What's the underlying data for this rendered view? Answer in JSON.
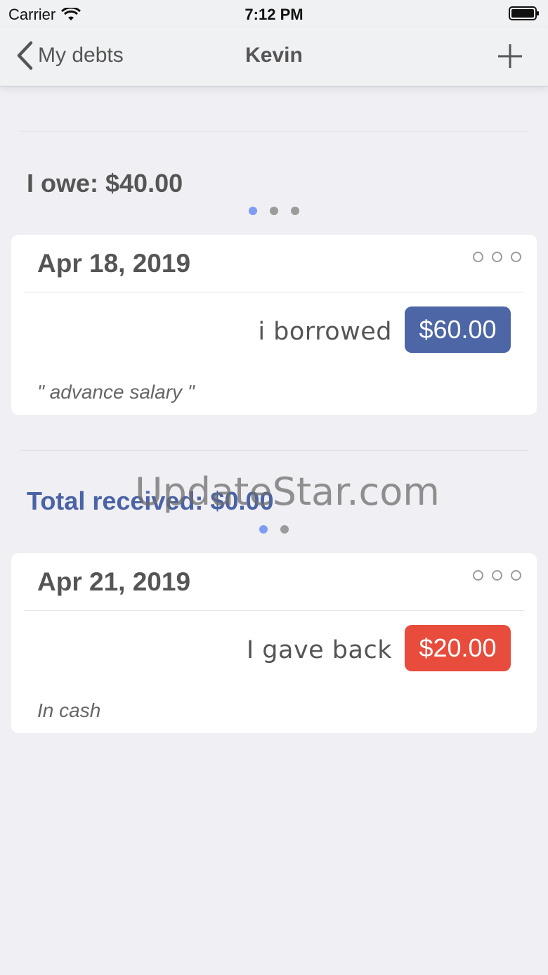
{
  "status_bar": {
    "carrier": "Carrier",
    "time": "7:12 PM"
  },
  "nav": {
    "back_label": "My debts",
    "title": "Kevin"
  },
  "owe_section": {
    "summary": "I owe: $40.00",
    "page_count": 3,
    "active_page": 0,
    "card": {
      "date": "Apr 18, 2019",
      "action": "i borrowed",
      "amount": "$60.00",
      "note": "\" advance salary \""
    }
  },
  "received_section": {
    "summary": "Total received: $0.00",
    "page_count": 2,
    "active_page": 0,
    "card": {
      "date": "Apr 21, 2019",
      "action": "I gave back",
      "amount": "$20.00",
      "note": "In cash"
    }
  },
  "watermark": "UpdateStar.com",
  "colors": {
    "borrowed_badge": "#4d66a5",
    "gave_back_badge": "#e74c3c",
    "received_text": "#4a63a5",
    "active_dot": "#7f9cf5"
  }
}
